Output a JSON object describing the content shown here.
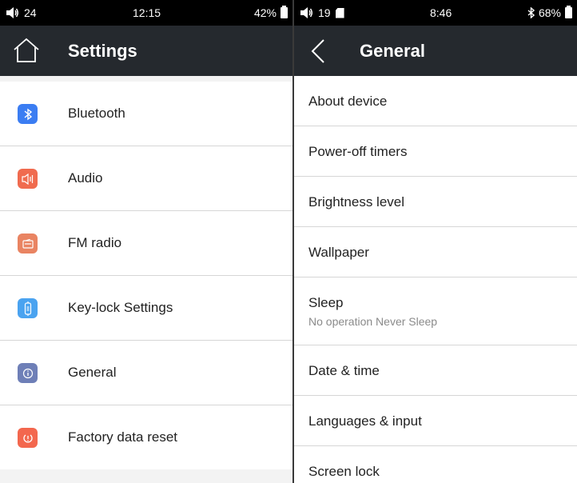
{
  "left_screen": {
    "status": {
      "volume": "24",
      "time": "12:15",
      "battery": "42%"
    },
    "title": "Settings",
    "items": [
      {
        "label": "Bluetooth",
        "icon": "bluetooth-icon",
        "color": "#3b7df2"
      },
      {
        "label": "Audio",
        "icon": "speaker-icon",
        "color": "#f06b4f"
      },
      {
        "label": "FM radio",
        "icon": "radio-icon",
        "color": "#e98462"
      },
      {
        "label": "Key-lock Settings",
        "icon": "key-lock-icon",
        "color": "#4aa3f0"
      },
      {
        "label": "General",
        "icon": "info-icon",
        "color": "#6e7fb7"
      },
      {
        "label": "Factory data reset",
        "icon": "reset-icon",
        "color": "#f3674e"
      }
    ]
  },
  "right_screen": {
    "status": {
      "volume": "19",
      "time": "8:46",
      "battery": "68%"
    },
    "title": "General",
    "items": [
      {
        "label": "About device"
      },
      {
        "label": "Power-off timers"
      },
      {
        "label": "Brightness level"
      },
      {
        "label": "Wallpaper"
      },
      {
        "label": "Sleep",
        "sub": "No operation Never Sleep"
      },
      {
        "label": "Date & time"
      },
      {
        "label": "Languages & input"
      },
      {
        "label": "Screen lock"
      }
    ]
  },
  "colors": {
    "appbar": "#25292e",
    "statusbar": "#000000",
    "divider": "#d6d6d6"
  }
}
